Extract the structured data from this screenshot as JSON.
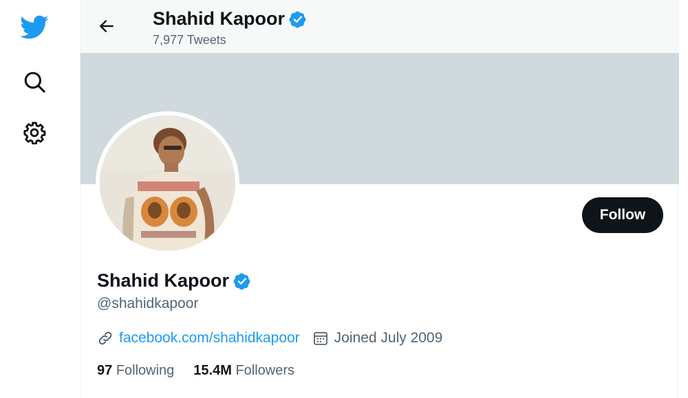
{
  "nav": {
    "icons": [
      "twitter-bird-icon",
      "search-icon",
      "settings-gear-icon"
    ],
    "brand_color": "#1d9bf0"
  },
  "header": {
    "name": "Shahid Kapoor",
    "tweet_count": "7,977 Tweets"
  },
  "profile": {
    "name": "Shahid Kapoor",
    "handle": "@shahidkapoor",
    "website": "facebook.com/shahidkapoor",
    "joined": "Joined July 2009",
    "following_count": "97",
    "following_label": "Following",
    "followers_count": "15.4M",
    "followers_label": "Followers",
    "verified": true
  },
  "actions": {
    "follow_label": "Follow"
  },
  "colors": {
    "banner": "#cfd9de",
    "accent": "#1d9bf0",
    "button": "#0f1419",
    "muted_text": "#536471"
  }
}
